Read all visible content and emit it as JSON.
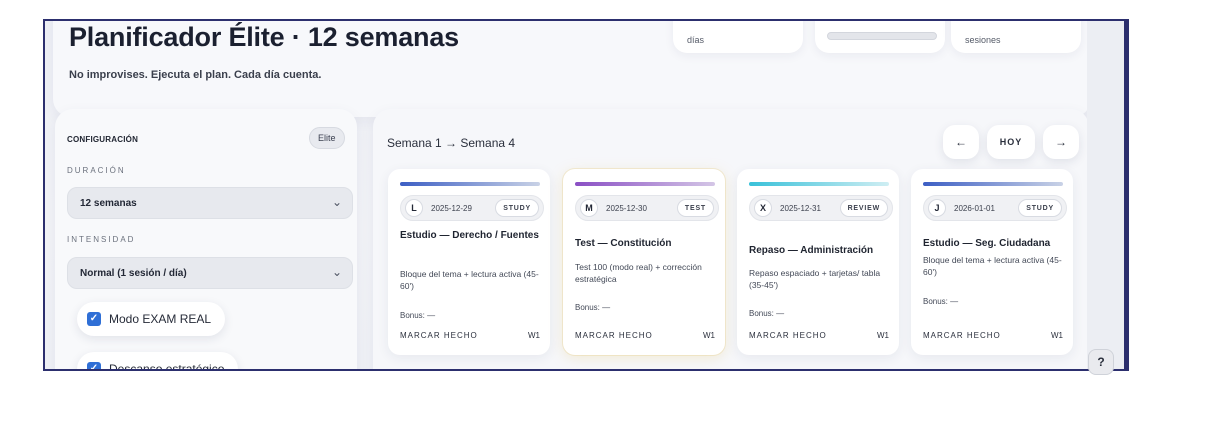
{
  "header": {
    "title": "Planificador Élite · 12 semanas",
    "subtitle": "No improvises. Ejecuta el plan. Cada día cuenta.",
    "stats": [
      {
        "label": "días"
      },
      {
        "progress": 0
      },
      {
        "label": "sesiones"
      }
    ]
  },
  "config": {
    "title": "CONFIGURACIÓN",
    "badge": "Elite",
    "duration_label": "DURACIÓN",
    "duration_value": "12 semanas",
    "intensity_label": "INTENSIDAD",
    "intensity_value": "Normal (1 sesión / día)",
    "exam_mode": {
      "label": "Modo EXAM REAL",
      "checked": true
    },
    "strategic_rest": {
      "label": "Descanso estratégico",
      "checked": true
    }
  },
  "calendar": {
    "range_label": "Semana 1 → Semana 4",
    "nav": {
      "prev": "←",
      "today": "HOY",
      "next": "→"
    },
    "cards": [
      {
        "letter": "L",
        "date": "2025-12-29",
        "type": "STUDY",
        "title": "Estudio — Derecho / Fuentes",
        "desc": "Bloque del tema + lectura activa (45-60')",
        "bonus": "Bonus: —",
        "done": "MARCAR HECHO",
        "week": "W1",
        "accent": "#3c64c8"
      },
      {
        "letter": "M",
        "date": "2025-12-30",
        "type": "TEST",
        "title": "Test — Constitución",
        "desc": "Test 100 (modo real) + corrección estratégica",
        "bonus": "Bonus: —",
        "done": "MARCAR HECHO",
        "week": "W1",
        "accent": "#8a56c8"
      },
      {
        "letter": "X",
        "date": "2025-12-31",
        "type": "REVIEW",
        "title": "Repaso — Administración",
        "desc": "Repaso espaciado + tarjetas/ tabla (35-45')",
        "bonus": "Bonus: —",
        "done": "MARCAR HECHO",
        "week": "W1",
        "accent": "#3cc0d8"
      },
      {
        "letter": "J",
        "date": "2026-01-01",
        "type": "STUDY",
        "title": "Estudio — Seg. Ciudadana",
        "desc": "Bloque del tema + lectura activa (45-60')",
        "bonus": "Bonus: —",
        "done": "MARCAR HECHO",
        "week": "W1",
        "accent": "#3c64c8"
      }
    ]
  },
  "help": "?"
}
